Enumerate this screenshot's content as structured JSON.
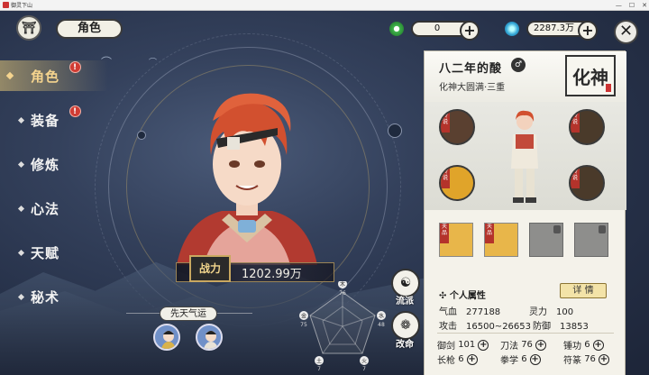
{
  "window": {
    "title": "御灵下山",
    "buttons": [
      "—",
      "☐",
      "✕"
    ]
  },
  "header": {
    "back_icon": "pavilion-icon",
    "page_title": "角色"
  },
  "resources": [
    {
      "icon": "jade-ring-icon",
      "value": "0",
      "color": "#3fb34b"
    },
    {
      "icon": "spirit-stone-icon",
      "value": "2287.3万",
      "color": "#36a9d8"
    }
  ],
  "nav": {
    "items": [
      {
        "label": "角色",
        "active": true,
        "badge": "!"
      },
      {
        "label": "装备",
        "active": false,
        "badge": "!"
      },
      {
        "label": "修炼",
        "active": false,
        "badge": ""
      },
      {
        "label": "心法",
        "active": false,
        "badge": ""
      },
      {
        "label": "天赋",
        "active": false,
        "badge": ""
      },
      {
        "label": "秘术",
        "active": false,
        "badge": ""
      }
    ]
  },
  "character": {
    "power_label": "战力",
    "power_value": "1202.99万",
    "fortune_title": "先天气运"
  },
  "side_buttons": [
    {
      "label": "流派",
      "icon": "sect-icon"
    },
    {
      "label": "改命",
      "icon": "fate-icon"
    }
  ],
  "radar": {
    "labels": [
      "木",
      "水",
      "火",
      "土",
      "金"
    ],
    "values": [
      "76",
      "48",
      "7",
      "7",
      "75"
    ]
  },
  "panel": {
    "name": "八二年的酸",
    "rank": "化神大圆满·三重",
    "seal_text": "化神",
    "equip_tags": [
      "传说",
      "传说",
      "传说",
      "传说"
    ],
    "skill_tags": [
      "天品",
      "天品"
    ],
    "attr_title": "个人属性",
    "detail_button": "详 情",
    "attributes": [
      {
        "label": "气血",
        "value": "277188"
      },
      {
        "label": "灵力",
        "value": "100"
      },
      {
        "label": "攻击",
        "value": "16500~26653"
      },
      {
        "label": "防御",
        "value": "13853"
      }
    ],
    "weapons": [
      {
        "label": "御剑",
        "value": "101"
      },
      {
        "label": "刀法",
        "value": "76"
      },
      {
        "label": "锤功",
        "value": "6"
      },
      {
        "label": "长枪",
        "value": "6"
      },
      {
        "label": "拳学",
        "value": "6"
      },
      {
        "label": "符篆",
        "value": "76"
      }
    ]
  }
}
